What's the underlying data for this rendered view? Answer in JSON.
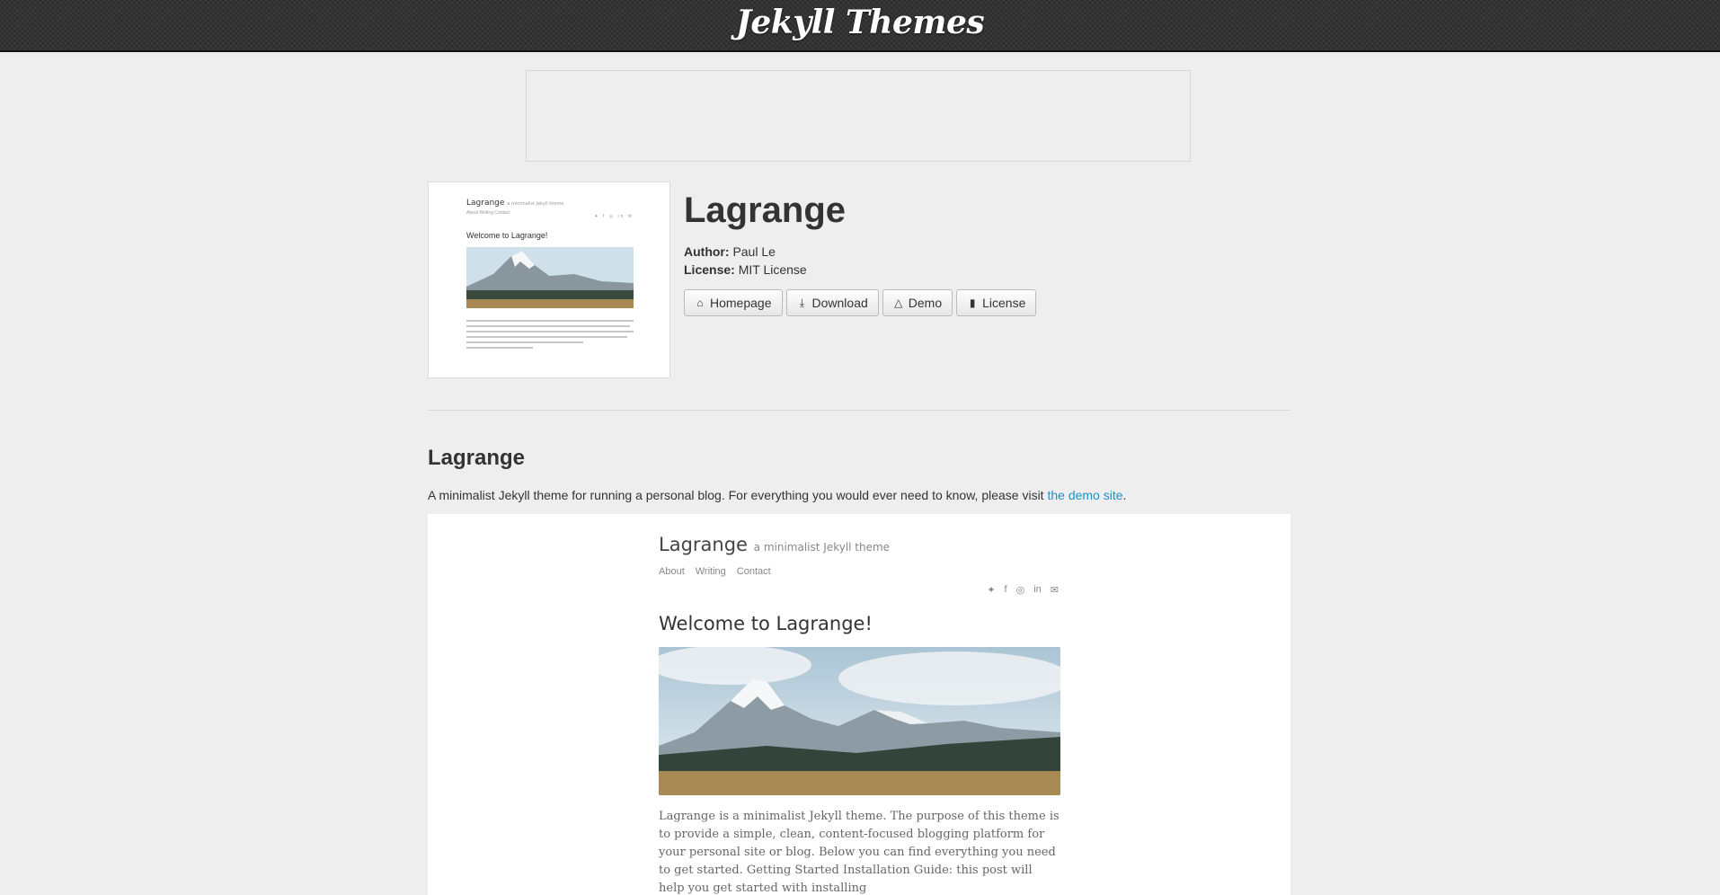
{
  "header": {
    "brand": "Jekyll Themes"
  },
  "theme": {
    "name": "Lagrange",
    "author_label": "Author:",
    "author": "Paul Le",
    "license_label": "License:",
    "license": "MIT License"
  },
  "buttons": {
    "homepage": "Homepage",
    "download": "Download",
    "demo": "Demo",
    "license": "License"
  },
  "thumbnail": {
    "title": "Lagrange",
    "subtitle": "a minimalist Jekyll theme",
    "nav": "About   Writing   Contact",
    "icons": "✦ f ◎ in ✉",
    "heading": "Welcome to Lagrange!"
  },
  "readme": {
    "title": "Lagrange",
    "description": "A minimalist Jekyll theme for running a personal blog. For everything you would ever need to know, please visit ",
    "link_text": "the demo site",
    "description_end": "."
  },
  "preview": {
    "site_title": "Lagrange",
    "site_subtitle": "a minimalist Jekyll theme",
    "nav": [
      "About",
      "Writing",
      "Contact"
    ],
    "social_icons": [
      "twitter-icon",
      "facebook-icon",
      "instagram-icon",
      "linkedin-icon",
      "email-icon"
    ],
    "heading": "Welcome to Lagrange!",
    "body": "Lagrange is a minimalist Jekyll theme. The purpose of this theme is to provide a simple, clean, content-focused blogging platform for your personal site or blog. Below you can find everything you need to get started. Getting Started Installation Guide: this post will help you get started with installing"
  }
}
